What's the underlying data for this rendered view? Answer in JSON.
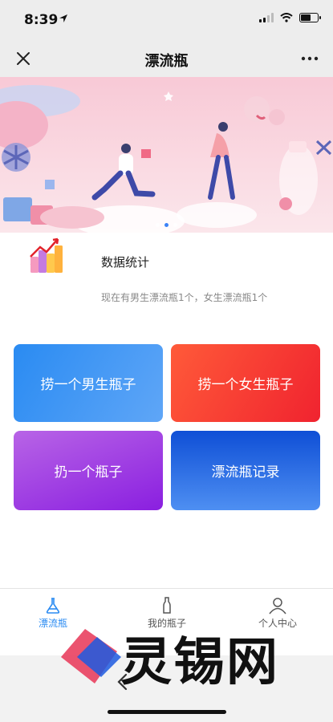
{
  "status": {
    "time": "8:39"
  },
  "nav": {
    "title": "漂流瓶",
    "close_icon": "close-icon",
    "more_icon": "more-icon"
  },
  "banner": {
    "slides": 3,
    "active_slide": 1
  },
  "stats": {
    "title": "数据统计",
    "description": "现在有男生漂流瓶1个，女生漂流瓶1个"
  },
  "actions": {
    "male": "捞一个男生瓶子",
    "female": "捞一个女生瓶子",
    "throw": "扔一个瓶子",
    "record": "漂流瓶记录"
  },
  "tabs": [
    {
      "label": "漂流瓶",
      "icon": "flask-icon",
      "active": true
    },
    {
      "label": "我的瓶子",
      "icon": "bottle-icon",
      "active": false
    },
    {
      "label": "个人中心",
      "icon": "user-icon",
      "active": false
    }
  ],
  "watermark": {
    "text": "灵锡网"
  },
  "colors": {
    "accent": "#2a8bf2",
    "male_button": "#2a8bf2",
    "female_button": "#f0232f",
    "throw_button": "#8a1fe0",
    "record_button": "#0f4fd6"
  }
}
